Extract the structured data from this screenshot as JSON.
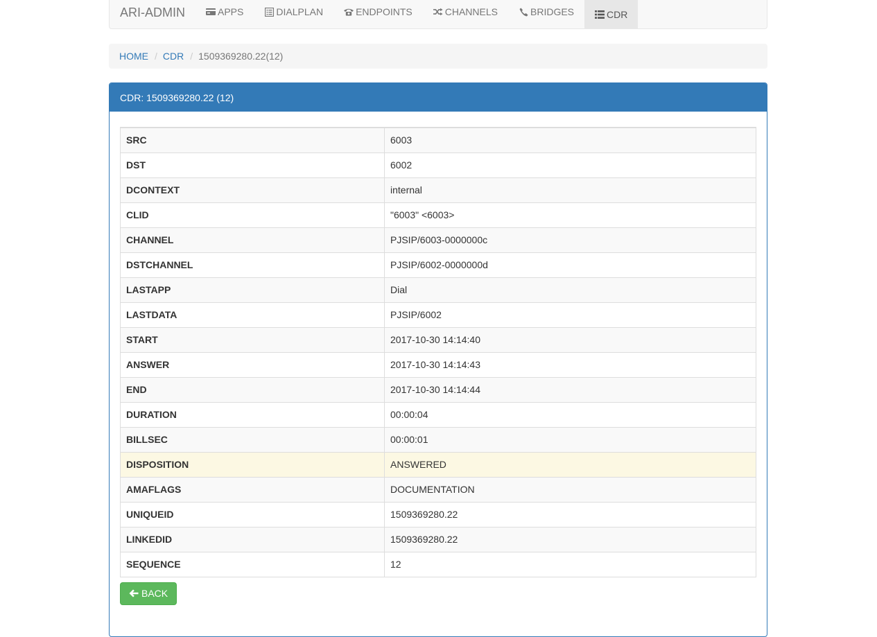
{
  "navbar": {
    "brand": "ARI-ADMIN",
    "items": [
      {
        "label": "APPS",
        "icon": "credit-card-icon",
        "active": false
      },
      {
        "label": "DIALPLAN",
        "icon": "list-alt-icon",
        "active": false
      },
      {
        "label": "ENDPOINTS",
        "icon": "phone-alt-icon",
        "active": false
      },
      {
        "label": "CHANNELS",
        "icon": "random-icon",
        "active": false
      },
      {
        "label": "BRIDGES",
        "icon": "earphone-icon",
        "active": false
      },
      {
        "label": "CDR",
        "icon": "list-icon",
        "active": true
      }
    ]
  },
  "breadcrumb": {
    "home": "HOME",
    "cdr": "CDR",
    "current": "1509369280.22(12)"
  },
  "panel": {
    "title": "CDR: 1509369280.22 (12)"
  },
  "rows": [
    {
      "key": "SRC",
      "value": "6003"
    },
    {
      "key": "DST",
      "value": "6002"
    },
    {
      "key": "DCONTEXT",
      "value": "internal"
    },
    {
      "key": "CLID",
      "value": "\"6003\" <6003>"
    },
    {
      "key": "CHANNEL",
      "value": "PJSIP/6003-0000000c"
    },
    {
      "key": "DSTCHANNEL",
      "value": "PJSIP/6002-0000000d"
    },
    {
      "key": "LASTAPP",
      "value": "Dial"
    },
    {
      "key": "LASTDATA",
      "value": "PJSIP/6002"
    },
    {
      "key": "START",
      "value": "2017-10-30 14:14:40"
    },
    {
      "key": "ANSWER",
      "value": "2017-10-30 14:14:43"
    },
    {
      "key": "END",
      "value": "2017-10-30 14:14:44"
    },
    {
      "key": "DURATION",
      "value": "00:00:04"
    },
    {
      "key": "BILLSEC",
      "value": "00:00:01"
    },
    {
      "key": "DISPOSITION",
      "value": "ANSWERED"
    },
    {
      "key": "AMAFLAGS",
      "value": "DOCUMENTATION"
    },
    {
      "key": "UNIQUEID",
      "value": "1509369280.22"
    },
    {
      "key": "LINKEDID",
      "value": "1509369280.22"
    },
    {
      "key": "SEQUENCE",
      "value": "12"
    }
  ],
  "actions": {
    "back_label": "BACK"
  },
  "colors": {
    "primary": "#337ab7",
    "success": "#5cb85c",
    "warning_row": "#fcf8e3"
  }
}
